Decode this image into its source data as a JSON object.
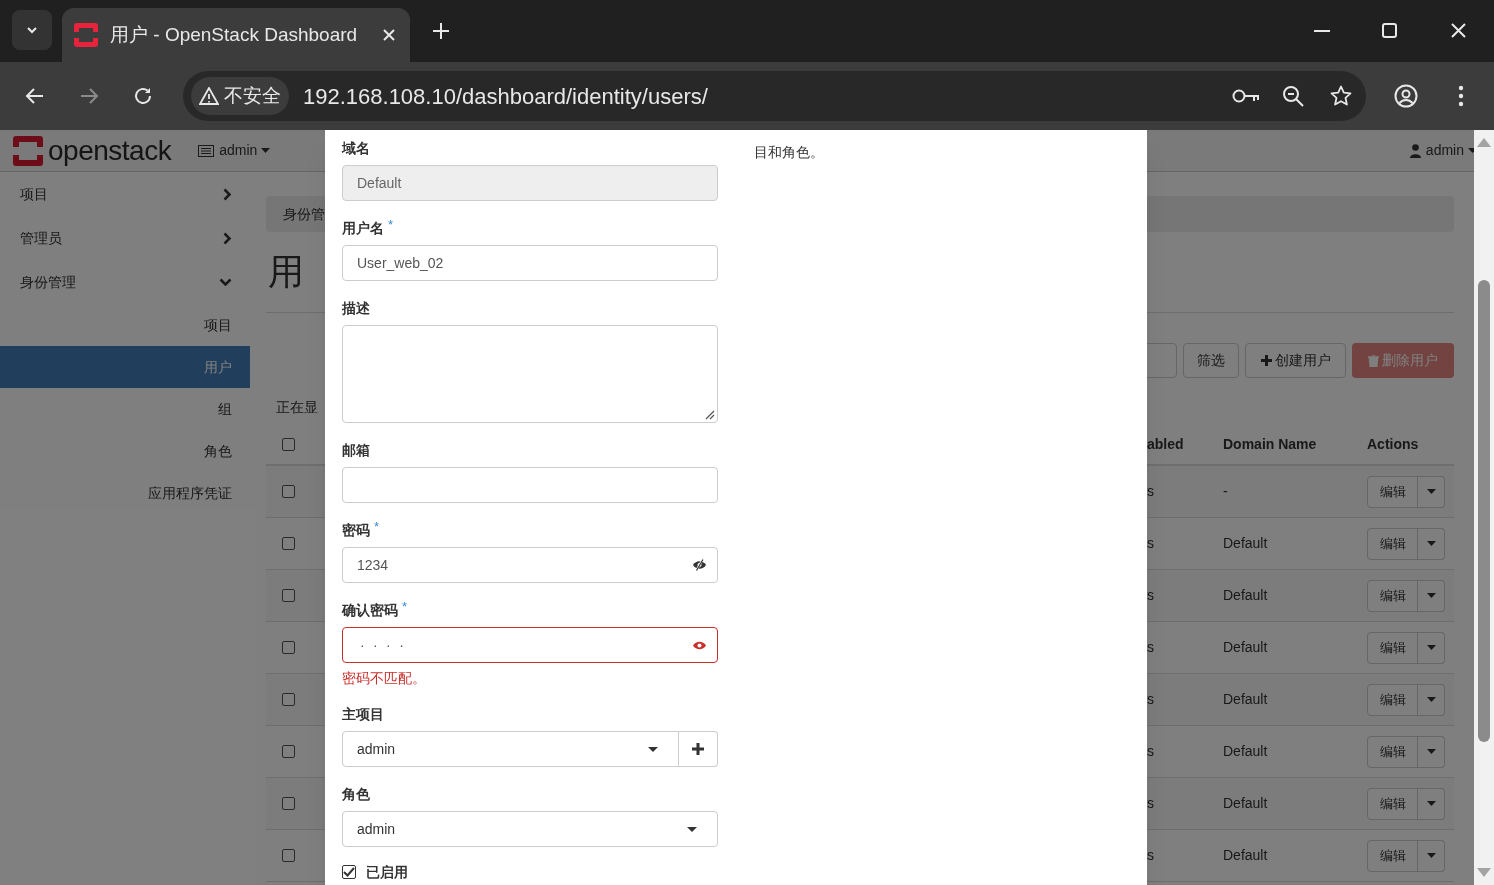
{
  "browser": {
    "tab": {
      "title": "用户 - OpenStack Dashboard",
      "selected": true
    },
    "security_label": "不安全",
    "url": "192.168.108.10/dashboard/identity/users/",
    "forward_disabled": true
  },
  "header": {
    "logo": "openstack",
    "project_menu": "admin",
    "user_menu": "admin"
  },
  "sidebar": {
    "items": [
      {
        "label": "项目",
        "expanded": false
      },
      {
        "label": "管理员",
        "expanded": false
      },
      {
        "label": "身份管理",
        "expanded": true,
        "children": [
          {
            "label": "项目",
            "selected": false
          },
          {
            "label": "用户",
            "selected": true
          },
          {
            "label": "组",
            "selected": false
          },
          {
            "label": "角色",
            "selected": false
          },
          {
            "label": "应用程序凭证",
            "selected": false
          }
        ]
      }
    ]
  },
  "breadcrumb": "身份管",
  "heading": "用",
  "toolbar": {
    "filter_button": "筛选",
    "create_button": "创建用户",
    "delete_button": "删除用户",
    "delete_disabled": true
  },
  "status_text": "正在显",
  "table": {
    "select_all_checked": false,
    "columns": [
      "abled",
      "Domain Name",
      "Actions"
    ],
    "rows": [
      {
        "checked": false,
        "column_3": "s",
        "domain": "-",
        "action": "编辑"
      },
      {
        "checked": false,
        "column_3": "s",
        "domain": "Default",
        "action": "编辑"
      },
      {
        "checked": false,
        "column_3": "s",
        "domain": "Default",
        "action": "编辑"
      },
      {
        "checked": false,
        "column_3": "s",
        "domain": "Default",
        "action": "编辑"
      },
      {
        "checked": false,
        "column_3": "s",
        "domain": "Default",
        "action": "编辑"
      },
      {
        "checked": false,
        "column_3": "s",
        "domain": "Default",
        "action": "编辑"
      },
      {
        "checked": false,
        "column_3": "s",
        "domain": "Default",
        "action": "编辑"
      },
      {
        "checked": false,
        "column_3": "s",
        "domain": "Default",
        "action": "编辑"
      }
    ]
  },
  "modal": {
    "description": "目和角色。",
    "fields": [
      {
        "kind": "text",
        "label": "域名",
        "value": "Default",
        "disabled": true
      },
      {
        "kind": "text",
        "label": "用户名",
        "required_mark": "*",
        "value": "User_web_02",
        "disabled": false
      },
      {
        "kind": "textarea",
        "label": "描述"
      },
      {
        "kind": "text",
        "label": "邮箱",
        "disabled": false
      },
      {
        "kind": "password",
        "label": "密码",
        "required_mark": "*",
        "value": "1234",
        "revealed": true
      },
      {
        "kind": "password",
        "label": "确认密码",
        "required_mark": "*",
        "value": "····",
        "revealed": false,
        "error": "密码不匹配。"
      },
      {
        "kind": "select",
        "label": "主项目",
        "value": "admin",
        "addable": true
      },
      {
        "kind": "select",
        "label": "角色",
        "value": "admin"
      },
      {
        "kind": "checkbox",
        "label": "已启用",
        "checked": true
      }
    ]
  }
}
